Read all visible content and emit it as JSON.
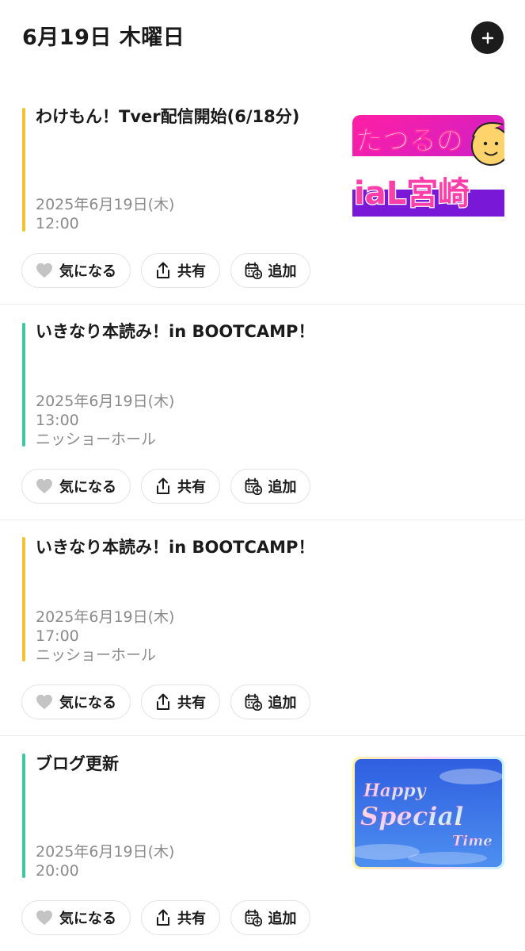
{
  "header": {
    "title": "6月19日 木曜日",
    "add_icon": "plus-icon"
  },
  "accent_colors": {
    "yellow": "#f0c431",
    "green": "#3cc8a0"
  },
  "actions": {
    "like_label": "気になる",
    "share_label": "共有",
    "add_label": "追加",
    "like_icon": "heart-icon",
    "share_icon": "share-icon",
    "calendar_icon": "calendar-add-icon"
  },
  "events": [
    {
      "title": "わけもん！Tver配信開始(6/18分)",
      "date": "2025年6月19日(木)",
      "time": "12:00",
      "venue": "",
      "accent": "#f0c431",
      "thumbnail": {
        "text_top": "たつるの",
        "text_bottom": "iaL宮崎"
      }
    },
    {
      "title": "いきなり本読み！in BOOTCAMP！",
      "date": "2025年6月19日(木)",
      "time": "13:00",
      "venue": "ニッショーホール",
      "accent": "#3cc8a0"
    },
    {
      "title": "いきなり本読み！in BOOTCAMP！",
      "date": "2025年6月19日(木)",
      "time": "17:00",
      "venue": "ニッショーホール",
      "accent": "#f0c431"
    },
    {
      "title": "ブログ更新",
      "date": "2025年6月19日(木)",
      "time": "20:00",
      "venue": "",
      "accent": "#3cc8a0",
      "thumbnail": {
        "line1": "Happy",
        "line2": "Special",
        "line3": "Time"
      }
    }
  ]
}
